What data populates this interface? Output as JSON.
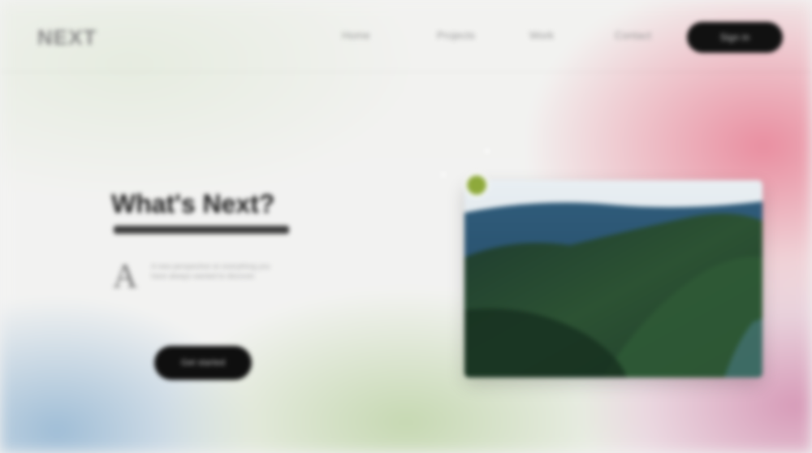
{
  "nav": {
    "logo": "NEXT",
    "links": [
      "Home",
      "Projects",
      "Work",
      "Contact"
    ],
    "cta_label": "Sign in"
  },
  "hero": {
    "title": "What's Next?",
    "cap_letter": "A",
    "body": "A new perspective on everything you have always wanted to discover."
  },
  "cta": {
    "label": "Get started"
  },
  "colors": {
    "accent_pink": "#e98ea0",
    "accent_green": "#8ea93b",
    "button_dark": "#111111"
  }
}
